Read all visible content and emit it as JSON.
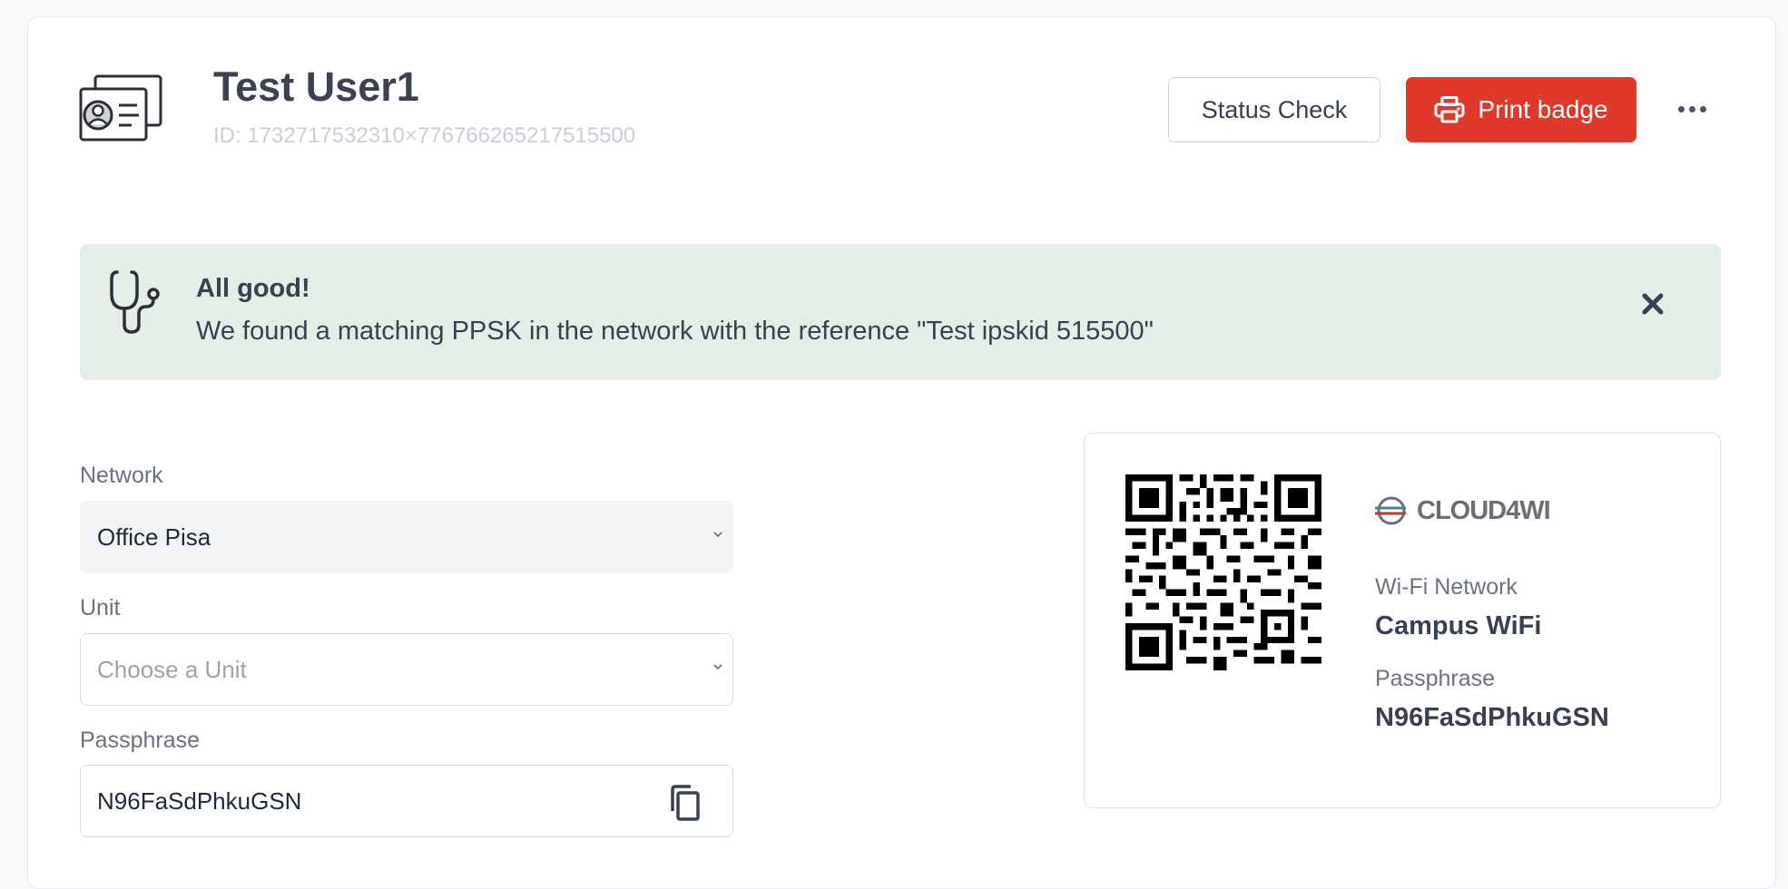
{
  "header": {
    "title": "Test User1",
    "id_text": "ID: 1732717532310×776766265217515500",
    "status_check_label": "Status Check",
    "print_badge_label": "Print badge"
  },
  "alert": {
    "title": "All good!",
    "message": "We found a matching PPSK in the network with the reference \"Test ipskid 515500\""
  },
  "form": {
    "network": {
      "label": "Network",
      "value": "Office Pisa"
    },
    "unit": {
      "label": "Unit",
      "placeholder": "Choose a Unit"
    },
    "passphrase": {
      "label": "Passphrase",
      "value": "N96FaSdPhkuGSN"
    }
  },
  "badge": {
    "logo_text": "CLOUD4WI",
    "network_label": "Wi-Fi Network",
    "network_value": "Campus WiFi",
    "passphrase_label": "Passphrase",
    "passphrase_value": "N96FaSdPhkuGSN"
  },
  "colors": {
    "primary": "#e0392b",
    "alert_bg": "#e5eee6"
  }
}
